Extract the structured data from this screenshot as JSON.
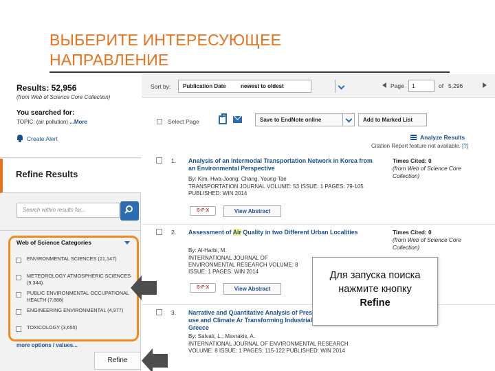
{
  "slide": {
    "title_line1": "ВЫБЕРИТЕ ИНТЕРЕСУЮЩЕЕ",
    "title_line2": "НАПРАВЛЕНИЕ",
    "accent_color": "#e8731d"
  },
  "sidebar": {
    "results_count": "Results: 52,956",
    "results_source": "(from Web of Science Core Collection)",
    "searched_for_label": "You searched for:",
    "topic_query": "TOPIC: (air pollution) ",
    "more_link": "...More",
    "create_alert": "Create Alert",
    "refine_results": "Refine Results",
    "search_placeholder": "Search within results for...",
    "categories_header": "Web of Science Categories",
    "categories": [
      {
        "label": "ENVIRONMENTAL SCIENCES (21,147)"
      },
      {
        "label": "METEOROLOGY ATMOSPHERIC SCIENCES (9,344)"
      },
      {
        "label": "PUBLIC ENVIRONMENTAL OCCUPATIONAL HEALTH (7,888)"
      },
      {
        "label": "ENGINEERING ENVIRONMENTAL (4,977)"
      },
      {
        "label": "TOXICOLOGY (3,655)"
      }
    ],
    "more_options": "more options / values...",
    "refine_button": "Refine"
  },
  "toolbar": {
    "sort_label": "Sort by:",
    "sort_field": "Publication Date",
    "sort_order": "newest to oldest",
    "page_label": "Page",
    "page_value": "1",
    "page_of": "of",
    "page_total": "5,296",
    "select_page": "Select Page",
    "save_endnote": "Save to EndNote online",
    "add_marked": "Add to Marked List",
    "analyze_results": "Analyze Results",
    "citation_note": "Citation Report feature not available. ",
    "citation_help": "[?]"
  },
  "results": [
    {
      "num": "1.",
      "title": "Analysis of an Intermodal Transportation Network in Korea from an Environmental Perspective",
      "authors": "By: Kim, Hwa-Joong; Chang, Young-Tae",
      "journal": "TRANSPORTATION JOURNAL  Volume: 53  Issue: 1  Pages: 79-105  Published: WIN 2014",
      "cited": "Times Cited: 0",
      "cited_source": "(from Web of Science Core Collection)",
      "sfx": "S·F·X",
      "view_abstract": "View Abstract"
    },
    {
      "num": "2.",
      "title_pre": "Assessment of ",
      "title_highlight": "Air",
      "title_post": " Quality in two Different Urban Localities",
      "authors": "By: Al-Harbi, M.",
      "journal": "INTERNATIONAL JOURNAL OF ENVIRONMENTAL RESEARCH  Volume: 8  Issue: 1  Pages:  WIN 2014",
      "cited": "Times Cited: 0",
      "cited_source": "(from Web of Science Core Collection)",
      "sfx": "S·F·X",
      "view_abstract": "View Abstract"
    },
    {
      "num": "3.",
      "title": "Narrative and Quantitative Analysis of Pressure, Land-use and Climate Ar Transforming Industrial Basin in Greece",
      "authors": "By: Salvati, L.; Mavrakis, A.",
      "journal": "INTERNATIONAL JOURNAL OF ENVIRONMENTAL RESEARCH  Volume: 8  Issue: 1  Pages: 115-122  Published: WIN 2014"
    }
  ],
  "callout": {
    "line1": "Для запуска поиска нажмите кнопку",
    "line2": "Refine"
  }
}
